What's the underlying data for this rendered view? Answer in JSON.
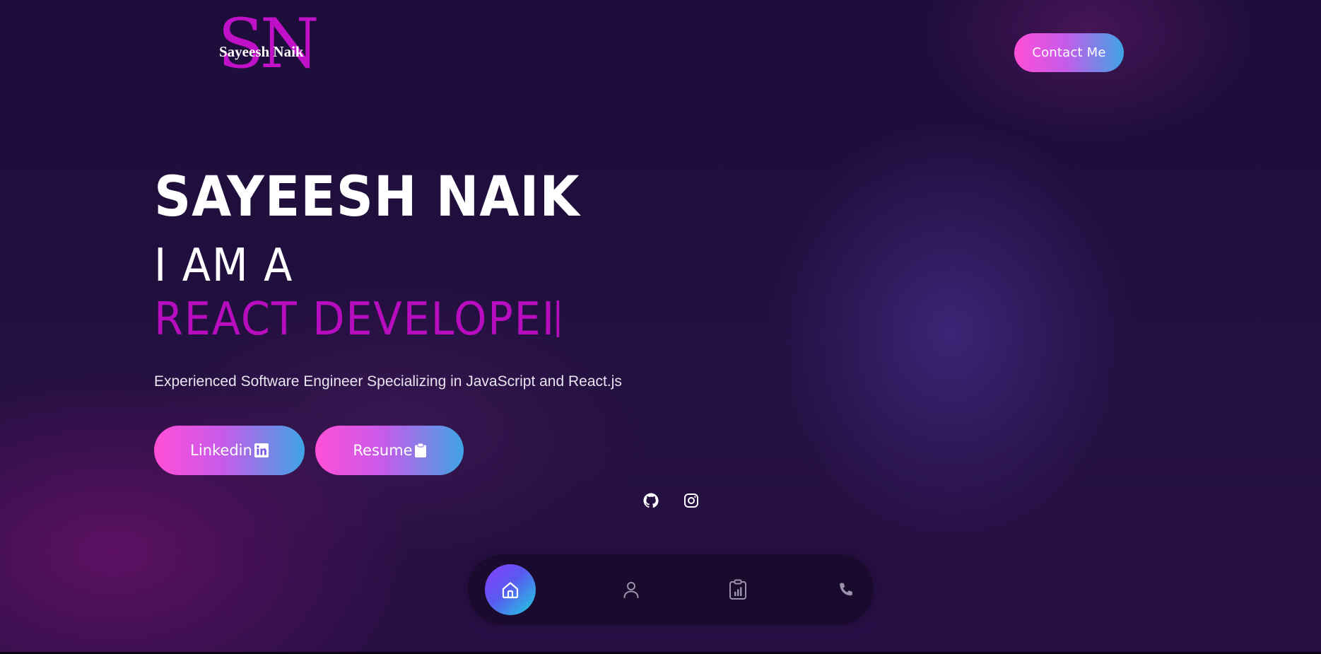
{
  "header": {
    "logo_letters": "SN",
    "logo_name": "Sayeesh Naik",
    "contact_label": "Contact Me"
  },
  "hero": {
    "name": "SAYEESH NAIK",
    "intro": "I AM A",
    "role_typed": "REACT DEVELOPEI",
    "subtitle": "Experienced Software Engineer Specializing in JavaScript and React.js"
  },
  "actions": {
    "linkedin_label": "Linkedin",
    "resume_label": "Resume"
  },
  "social": {
    "icons": [
      "github-icon",
      "instagram-icon"
    ]
  },
  "bottom_nav": {
    "items": [
      "home-icon",
      "user-icon",
      "clipboard-chart-icon",
      "phone-icon"
    ],
    "active": "home-icon"
  },
  "colors": {
    "background": "#1e0e3c",
    "accent_magenta": "#b80dbe",
    "gradient_start": "#ff4fd8",
    "gradient_end": "#3fa4e6",
    "nav_bg": "#1a0b2e"
  }
}
